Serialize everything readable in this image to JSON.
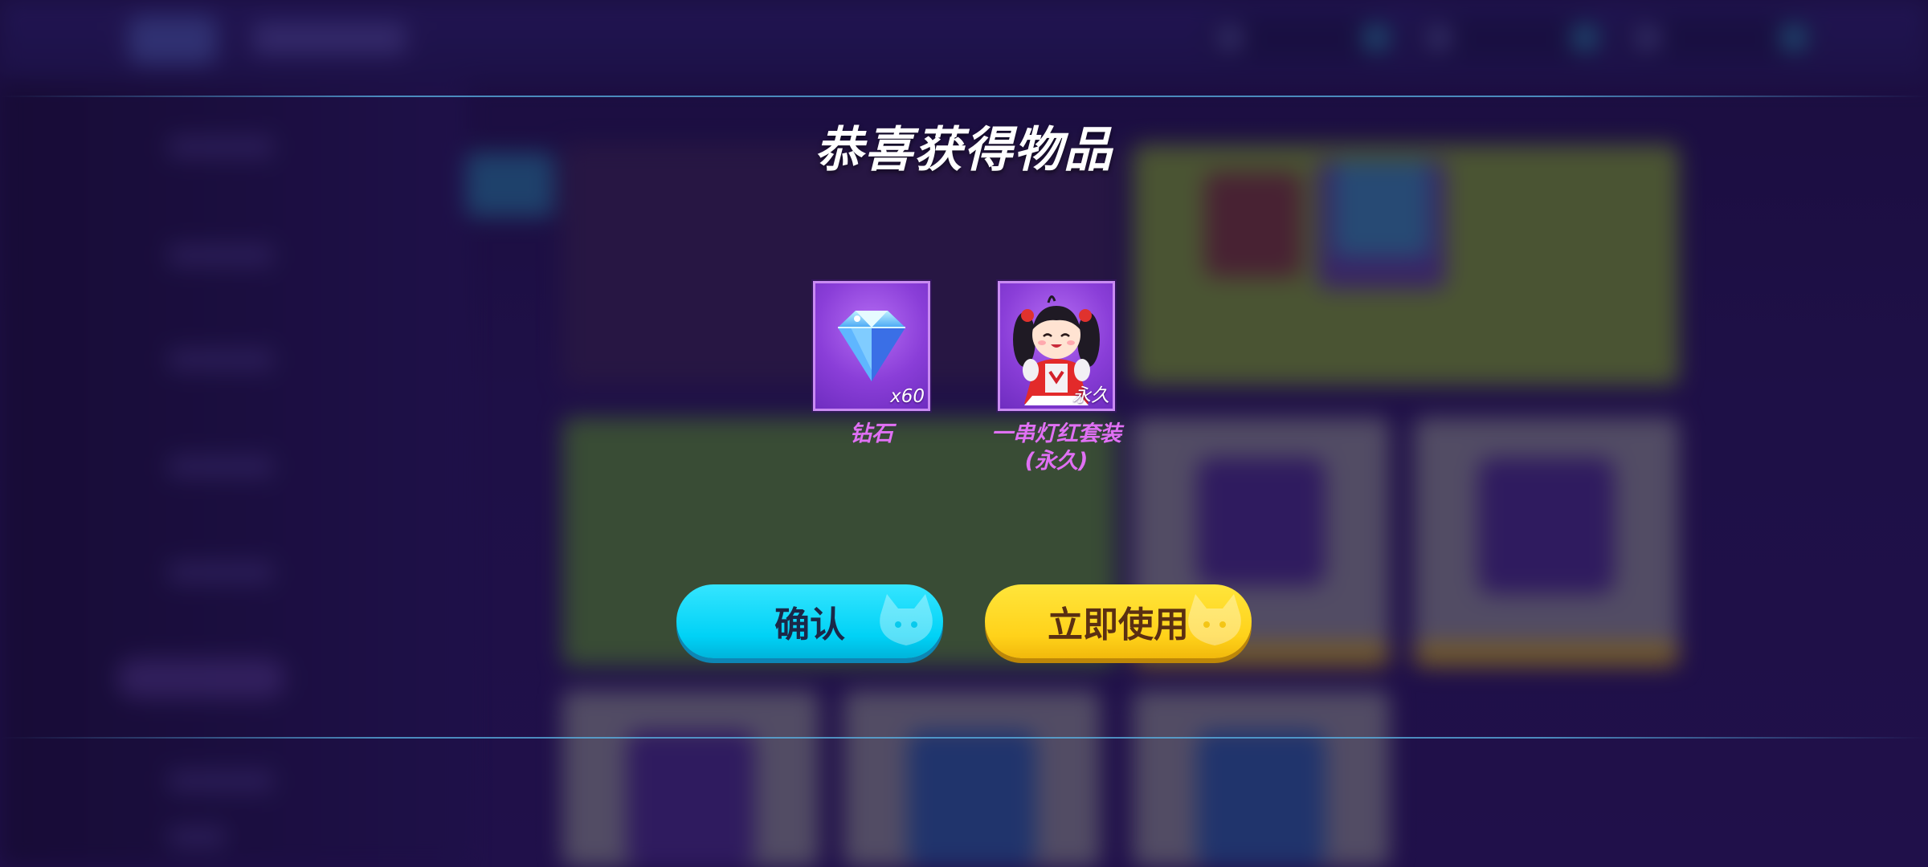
{
  "dialog": {
    "title": "恭喜获得物品",
    "items": [
      {
        "icon": "diamond-icon",
        "quantity": "x60",
        "name": "钻石"
      },
      {
        "icon": "character-outfit-icon",
        "quantity": "永久",
        "name": "一串灯红套装",
        "name_suffix": "(永久)"
      }
    ],
    "buttons": {
      "confirm_label": "确认",
      "use_label": "立即使用"
    }
  },
  "colors": {
    "confirm_button": "#00d2f6",
    "use_button": "#ffd21a",
    "item_name": "#e070f4",
    "item_frame": "#8a3ed8"
  }
}
